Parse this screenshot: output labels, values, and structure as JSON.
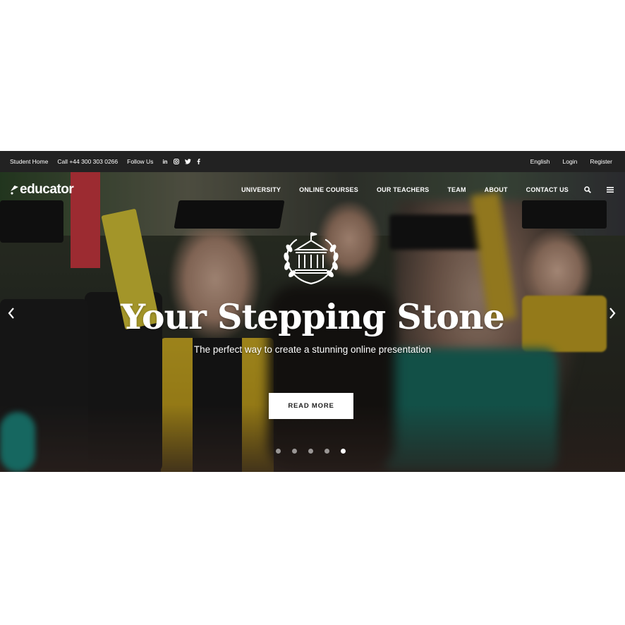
{
  "topbar": {
    "student_home": "Student Home",
    "phone": "Call +44 300 303 0266",
    "follow_us": "Follow Us",
    "social_icons": [
      "linkedin-icon",
      "instagram-icon",
      "twitter-icon",
      "facebook-icon"
    ],
    "language": "English",
    "login": "Login",
    "register": "Register"
  },
  "header": {
    "logo": "educator",
    "nav": [
      "UNIVERSITY",
      "ONLINE COURSES",
      "OUR TEACHERS",
      "TEAM",
      "ABOUT",
      "CONTACT US"
    ],
    "icons": [
      "search-icon",
      "menu-icon"
    ]
  },
  "hero": {
    "emblem_icon": "university-building-laurel-icon",
    "title": "Your Stepping Stone",
    "subtitle": "The perfect way to create a stunning online presentation",
    "cta_label": "READ MORE",
    "slides_total": 5,
    "active_slide": 5
  },
  "colors": {
    "topbar_bg": "#222222",
    "text": "#ffffff",
    "cta_bg": "#ffffff",
    "cta_text": "#222222"
  }
}
